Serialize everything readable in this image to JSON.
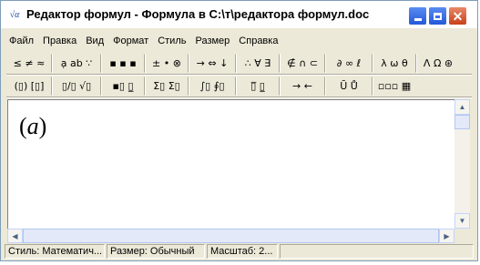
{
  "window": {
    "title": "Редактор формул - Формула в C:\\т\\редактора формул.doc",
    "app_icon_text": "√α"
  },
  "menu": [
    "Файл",
    "Правка",
    "Вид",
    "Формат",
    "Стиль",
    "Размер",
    "Справка"
  ],
  "toolbar_row1": [
    "≤ ≠ ≈",
    "ạ ab ∵",
    "▪ ▪ ▪",
    "± • ⊗",
    "→ ⇔ ↓",
    "∴ ∀ ∃",
    "∉ ∩ ⊂",
    "∂ ∞ ℓ",
    "λ ω θ",
    "Λ Ω ⊛"
  ],
  "toolbar_row2": [
    "(▯) [▯]",
    "▯/▯ √▯",
    "▪▯ ▯̲",
    "Σ▯ Σ▯",
    "∫▯ ∮▯",
    "▯̅ ▯̲",
    "→ ←",
    "Ū Ů",
    "▫▫▫ ▦"
  ],
  "editor": {
    "formula_open": "(",
    "formula_var": "a",
    "formula_close": ")"
  },
  "status": {
    "style": "Стиль: Математич...",
    "size": "Размер: Обычный",
    "zoom": "Масштаб: 2..."
  }
}
